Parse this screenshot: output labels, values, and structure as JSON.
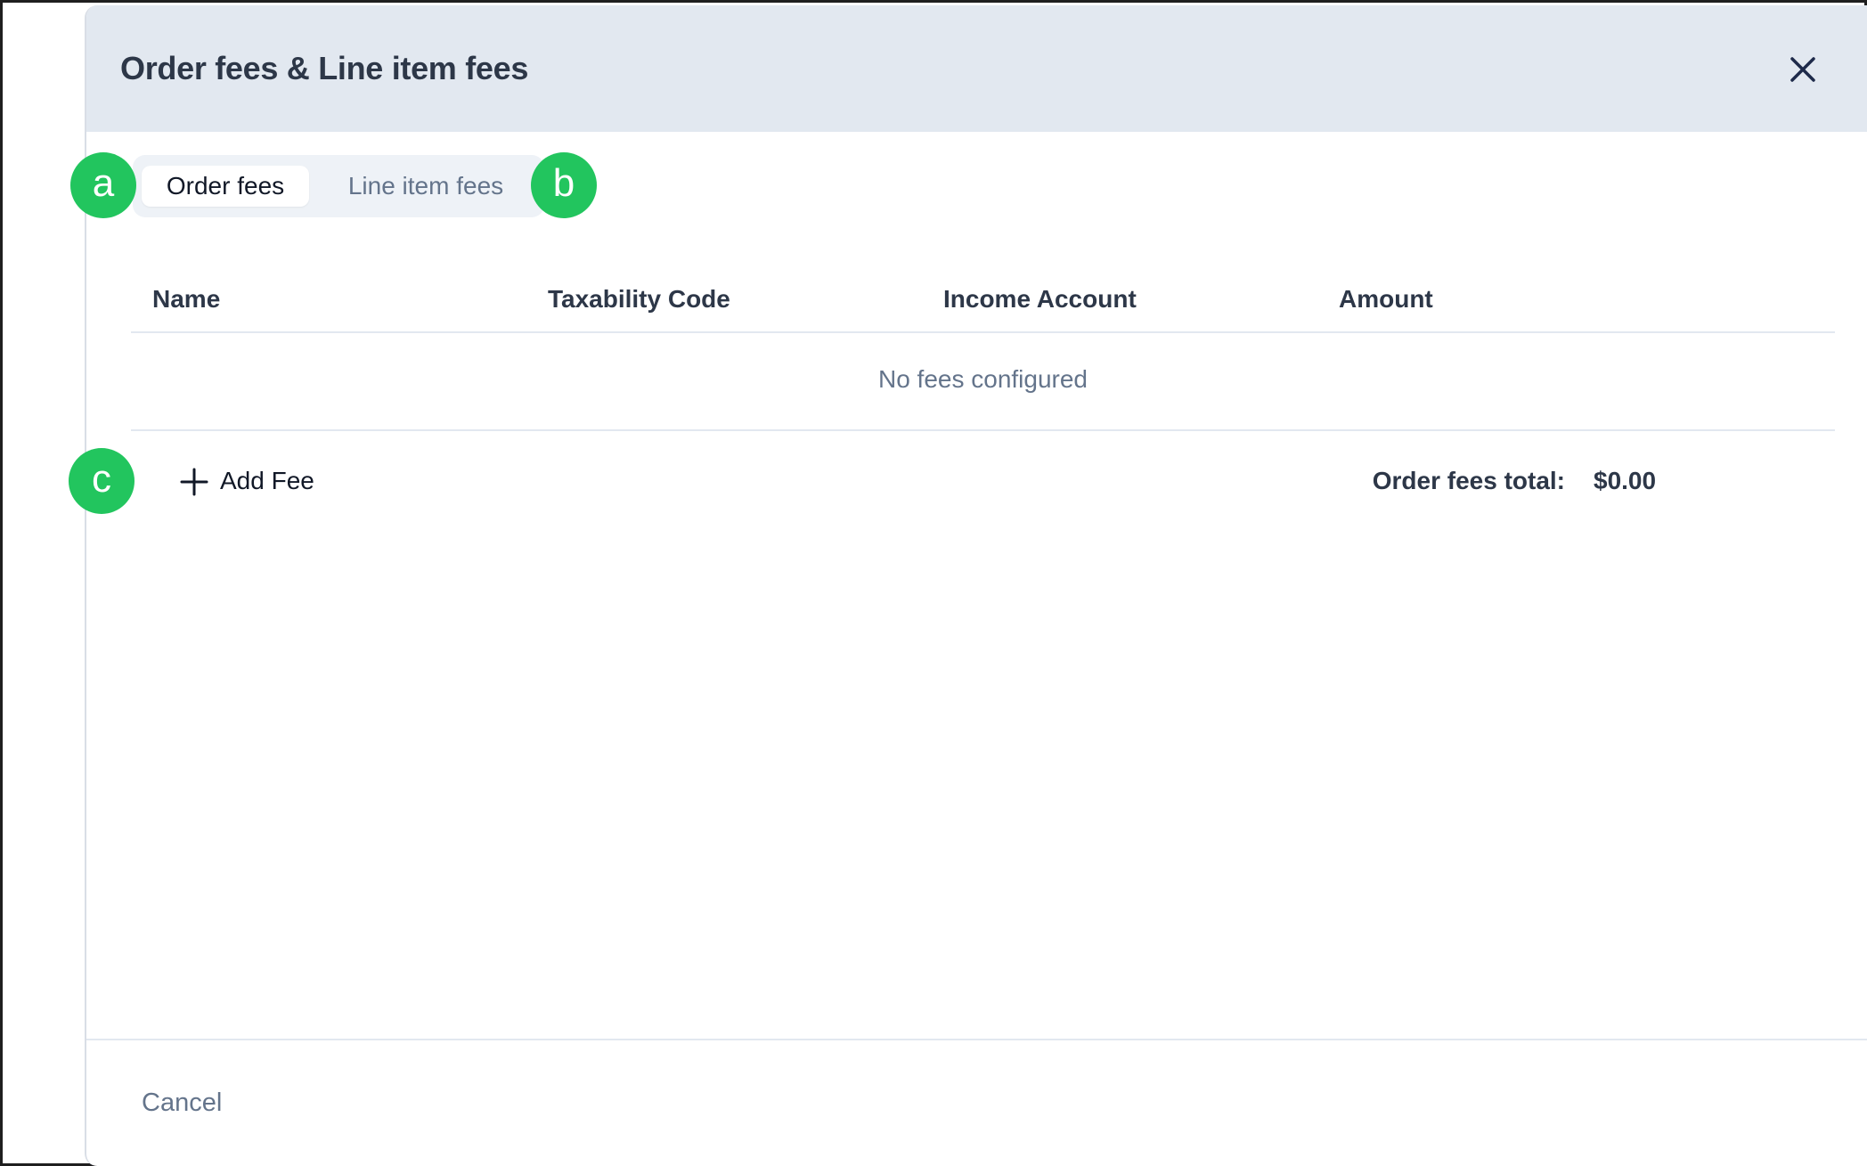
{
  "modal": {
    "title": "Order fees & Line item fees",
    "close_icon": "close-icon"
  },
  "tabs": [
    {
      "label": "Order fees",
      "active": true
    },
    {
      "label": "Line item fees",
      "active": false
    }
  ],
  "annotations": [
    "a",
    "b",
    "c"
  ],
  "table": {
    "columns": [
      "Name",
      "Taxability Code",
      "Income Account",
      "Amount"
    ],
    "empty_message": "No fees configured"
  },
  "actions": {
    "add_fee_label": "Add Fee",
    "add_fee_icon": "plus-icon"
  },
  "totals": {
    "label": "Order fees total:",
    "value": "$0.00"
  },
  "footer": {
    "cancel_label": "Cancel"
  },
  "colors": {
    "header_bg": "#e2e8f0",
    "badge": "#22c55e",
    "text_dark": "#2d3748",
    "text_muted": "#64748b"
  }
}
